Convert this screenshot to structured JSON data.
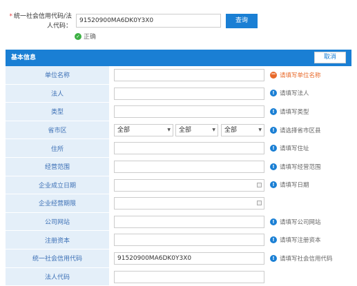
{
  "search": {
    "required_mark": "*",
    "label": "统一社会信用代码/法人代码：",
    "value": "91520900MA6DK0Y3X0",
    "query_label": "查询",
    "status": "正确"
  },
  "panel": {
    "title": "基本信息",
    "cancel_label": "取消"
  },
  "form": {
    "rows": [
      {
        "label": "单位名称",
        "value": "",
        "hint": "请填写单位名称"
      },
      {
        "label": "法人",
        "value": "",
        "hint": "请填写法人"
      },
      {
        "label": "类型",
        "value": "",
        "hint": "请填写类型"
      },
      {
        "label": "省市区",
        "selects": [
          "全部",
          "全部",
          "全部"
        ],
        "hint": "请选择省市区县"
      },
      {
        "label": "住所",
        "value": "",
        "hint": "请填写住址"
      },
      {
        "label": "经营范围",
        "value": "",
        "hint": "请填写经营范围"
      },
      {
        "label": "企业成立日期",
        "value": "",
        "hint": "请填写日期"
      },
      {
        "label": "企业经营期限",
        "value": "",
        "hint": ""
      },
      {
        "label": "公司网站",
        "value": "",
        "hint": "请填写公司网站"
      },
      {
        "label": "注册资本",
        "value": "",
        "hint": "请填写注册资本"
      },
      {
        "label": "统一社会信用代码",
        "value": "91520900MA6DK0Y3X0",
        "hint": "请填写社会信用代码"
      },
      {
        "label": "法人代码",
        "value": "",
        "hint": ""
      }
    ]
  },
  "colors": {
    "accent": "#1a7fd4",
    "label_bg": "#e4eff9",
    "label_text": "#3b6fb5",
    "warning": "#e8692a",
    "success": "#3cb043"
  }
}
